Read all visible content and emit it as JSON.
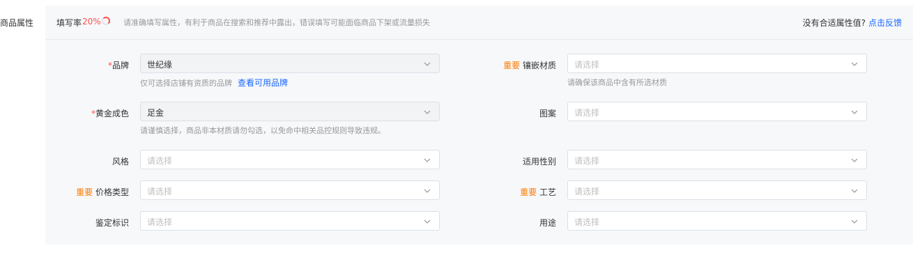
{
  "section": {
    "title": "商品属性"
  },
  "header": {
    "fill_label": "填写率",
    "fill_rate": "20%",
    "fill_rate_value": 0.2,
    "hint": "请准确填写属性，有利于商品在搜索和推荐中露出，错误填写可能面临商品下架或流量损失",
    "feedback_question": "没有合适属性值?",
    "feedback_link": "点击反馈"
  },
  "colors": {
    "required": "#ff4d4f",
    "important": "#ff7a00",
    "link": "#1966ff",
    "panel_bg": "#f7f8fa"
  },
  "fields": {
    "brand": {
      "required_mark": "*",
      "label": "品牌",
      "value": "世纪缘",
      "helper": "仅可选择店铺有资质的品牌",
      "helper_link": "查看可用品牌"
    },
    "inlay_material": {
      "tag": "重要",
      "label": "镶嵌材质",
      "placeholder": "请选择",
      "helper": "请确保该商品中含有所选材质"
    },
    "gold_purity": {
      "required_mark": "*",
      "label": "黄金成色",
      "value": "足金",
      "helper": "请谨慎选择，商品非本材质请勿勾选，以免命中相关品控规则导致违规。"
    },
    "pattern": {
      "label": "图案",
      "placeholder": "请选择"
    },
    "style": {
      "label": "风格",
      "placeholder": "请选择"
    },
    "gender": {
      "label": "适用性别",
      "placeholder": "请选择"
    },
    "price_type": {
      "tag": "重要",
      "label": "价格类型",
      "placeholder": "请选择"
    },
    "craft": {
      "tag": "重要",
      "label": "工艺",
      "placeholder": "请选择"
    },
    "identification": {
      "label": "鉴定标识",
      "placeholder": "请选择"
    },
    "usage": {
      "label": "用途",
      "placeholder": "请选择"
    }
  }
}
